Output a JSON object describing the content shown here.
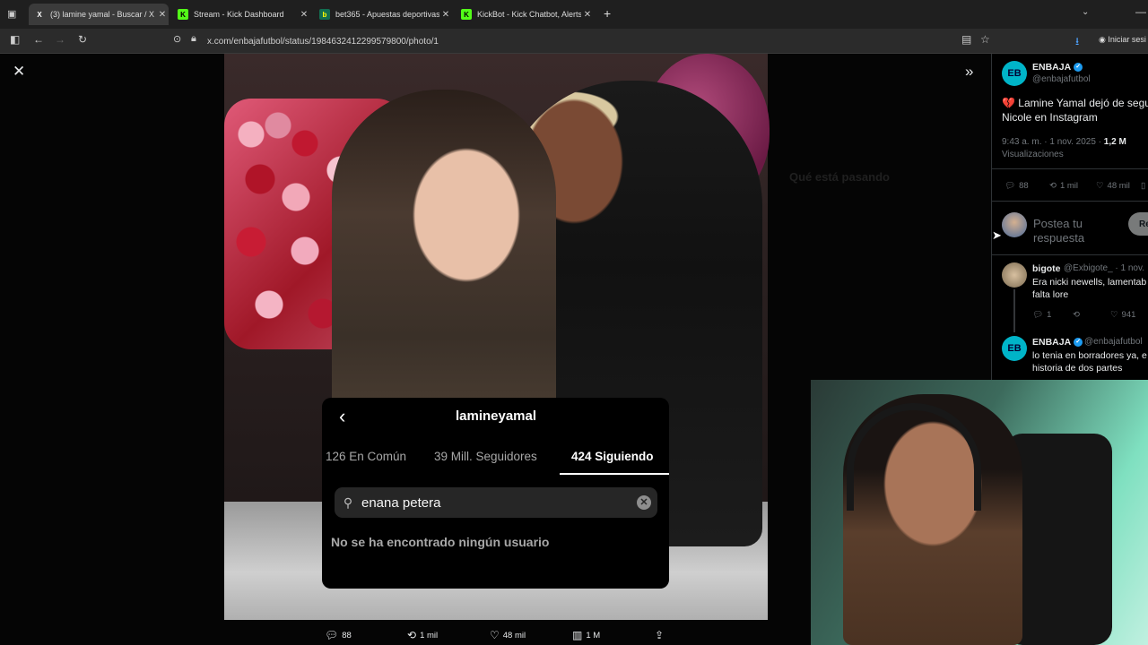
{
  "browser": {
    "tabs": [
      {
        "label": "(3) lamine yamal - Buscar / X",
        "favicon": "x-icon",
        "active": true
      },
      {
        "label": "Stream - Kick Dashboard",
        "favicon": "kick-icon",
        "active": false
      },
      {
        "label": "bet365 - Apuestas deportivas en",
        "favicon": "bet365-icon",
        "active": false
      },
      {
        "label": "KickBot - Kick Chatbot, Alerts, T",
        "favicon": "kick-icon",
        "active": false
      }
    ],
    "url": "x.com/enbajafutbol/status/1984632412299579800/photo/1",
    "profile_label": "Iniciar sesi"
  },
  "photo": {
    "actions": {
      "replies": "88",
      "reposts": "1 mil",
      "likes": "48 mil",
      "views": "1 M"
    }
  },
  "instagram_overlay": {
    "username": "lamineyamal",
    "tabs": [
      "126 En Común",
      "39 Mill. Seguidores",
      "424 Siguiendo"
    ],
    "search_value": "enana petera",
    "empty_message": "No se ha encontrado ningún usuario"
  },
  "background_sidebar": {
    "trending_heading": "Qué está pasando"
  },
  "tweet": {
    "author": "ENBAJA",
    "handle": "@enbajafutbol",
    "text_line1": "💔 Lamine Yamal dejó de segu",
    "text_line2": "Nicole en Instagram",
    "time": "9:43 a. m. · 1 nov. 2025 · ",
    "views_count": "1,2 M",
    "views_label": "Visualizaciones",
    "replies": "88",
    "reposts": "1 mil",
    "likes": "48 mil",
    "reply_placeholder_1": "Postea tu",
    "reply_placeholder_2": "respuesta",
    "reply_button": "Re"
  },
  "replies": [
    {
      "author": "bigote",
      "handle": "@Exbigote_ · 1 nov.",
      "line1": "Era nicki newells, lamentab",
      "line2": "falta lore",
      "replies": "1",
      "likes": "941"
    },
    {
      "author": "ENBAJA",
      "handle": "@enbajafutbol",
      "line1": "lo tenia en borradores ya, e",
      "line2": "historia de dos partes"
    }
  ],
  "colors": {
    "accent": "#1d9bf0",
    "ig_bg": "#000000",
    "x_bg": "#000000"
  }
}
